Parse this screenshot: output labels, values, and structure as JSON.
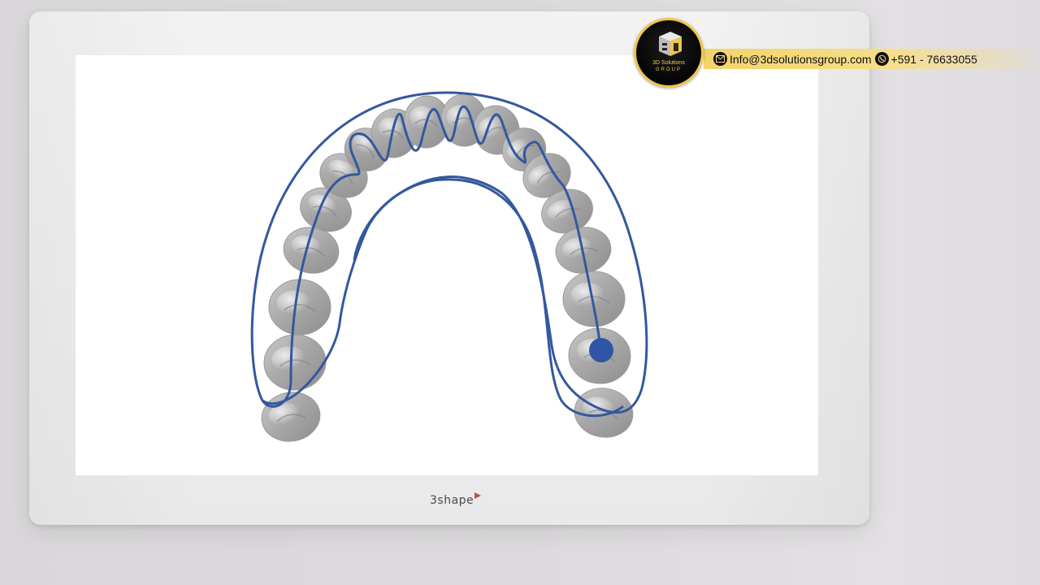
{
  "monitor": {
    "brand": "3shape"
  },
  "overlay": {
    "logo": {
      "line1": "3D Solutions",
      "line2": "GROUP"
    },
    "email": "Info@3dsolutionsgroup.com",
    "phone": "+591 - 76633055",
    "icons": {
      "email": "envelope-icon",
      "phone": "whatsapp-icon"
    },
    "colors": {
      "accent": "#f3d36a",
      "tray_line": "#34589e",
      "scan_point": "#2f55a4"
    }
  }
}
